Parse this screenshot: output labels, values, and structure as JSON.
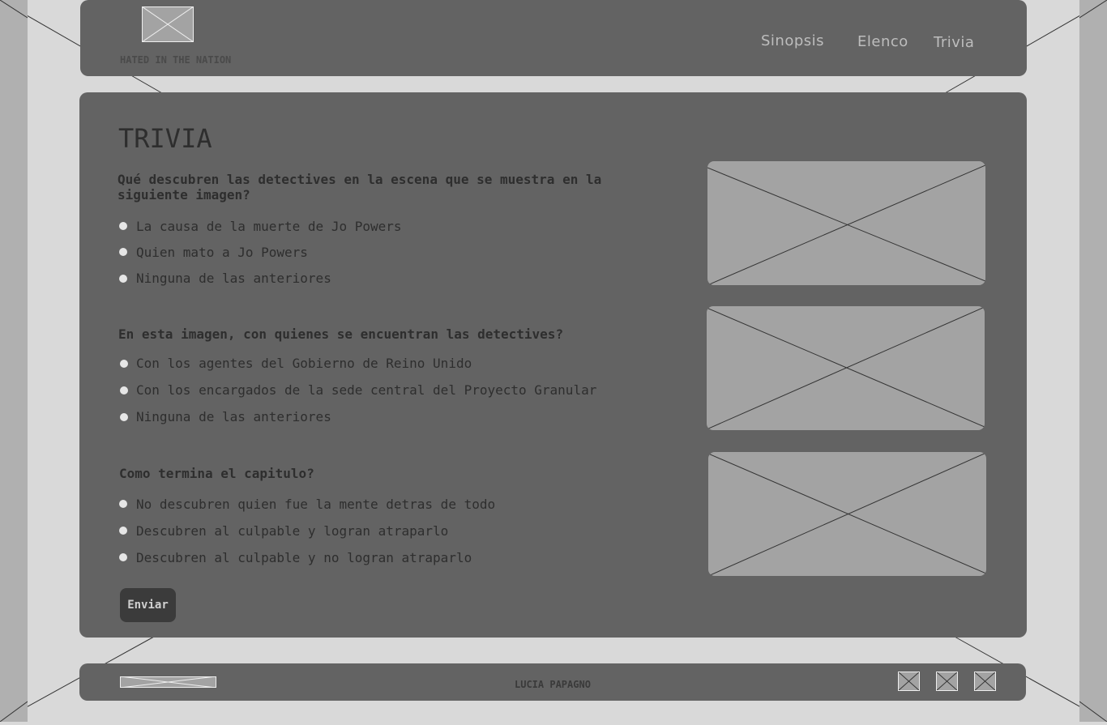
{
  "header": {
    "brand": "HATED IN THE NATION",
    "logo_icon": "image-placeholder-icon",
    "nav": [
      "Sinopsis",
      "Elenco",
      "Trivia"
    ]
  },
  "main": {
    "title": "TRIVIA",
    "questions": [
      {
        "text": "Qué descubren las detectives en la escena que se muestra en la siguiente imagen?",
        "options": [
          "La causa de la muerte de Jo Powers",
          "Quien mato a Jo Powers",
          "Ninguna de las anteriores"
        ]
      },
      {
        "text": "En esta imagen, con quienes se encuentran las detectives?",
        "options": [
          "Con los agentes del Gobierno de Reino Unido",
          "Con los encargados de la sede central del Proyecto Granular",
          "Ninguna de las anteriores"
        ]
      },
      {
        "text": "Como termina el capitulo?",
        "options": [
          "No descubren quien fue la mente detras de todo",
          "Descubren al culpable y logran atraparlo",
          "Descubren al culpable y no logran atraparlo"
        ]
      }
    ],
    "submit_label": "Enviar"
  },
  "footer": {
    "author": "LUCIA PAPAGNO",
    "social_icons": [
      "image-placeholder-icon",
      "image-placeholder-icon",
      "image-placeholder-icon"
    ]
  },
  "colors": {
    "page_bg": "#d9d9d9",
    "panel": "#636363",
    "placeholder": "#a3a3a3",
    "button": "#3b3b3b"
  }
}
